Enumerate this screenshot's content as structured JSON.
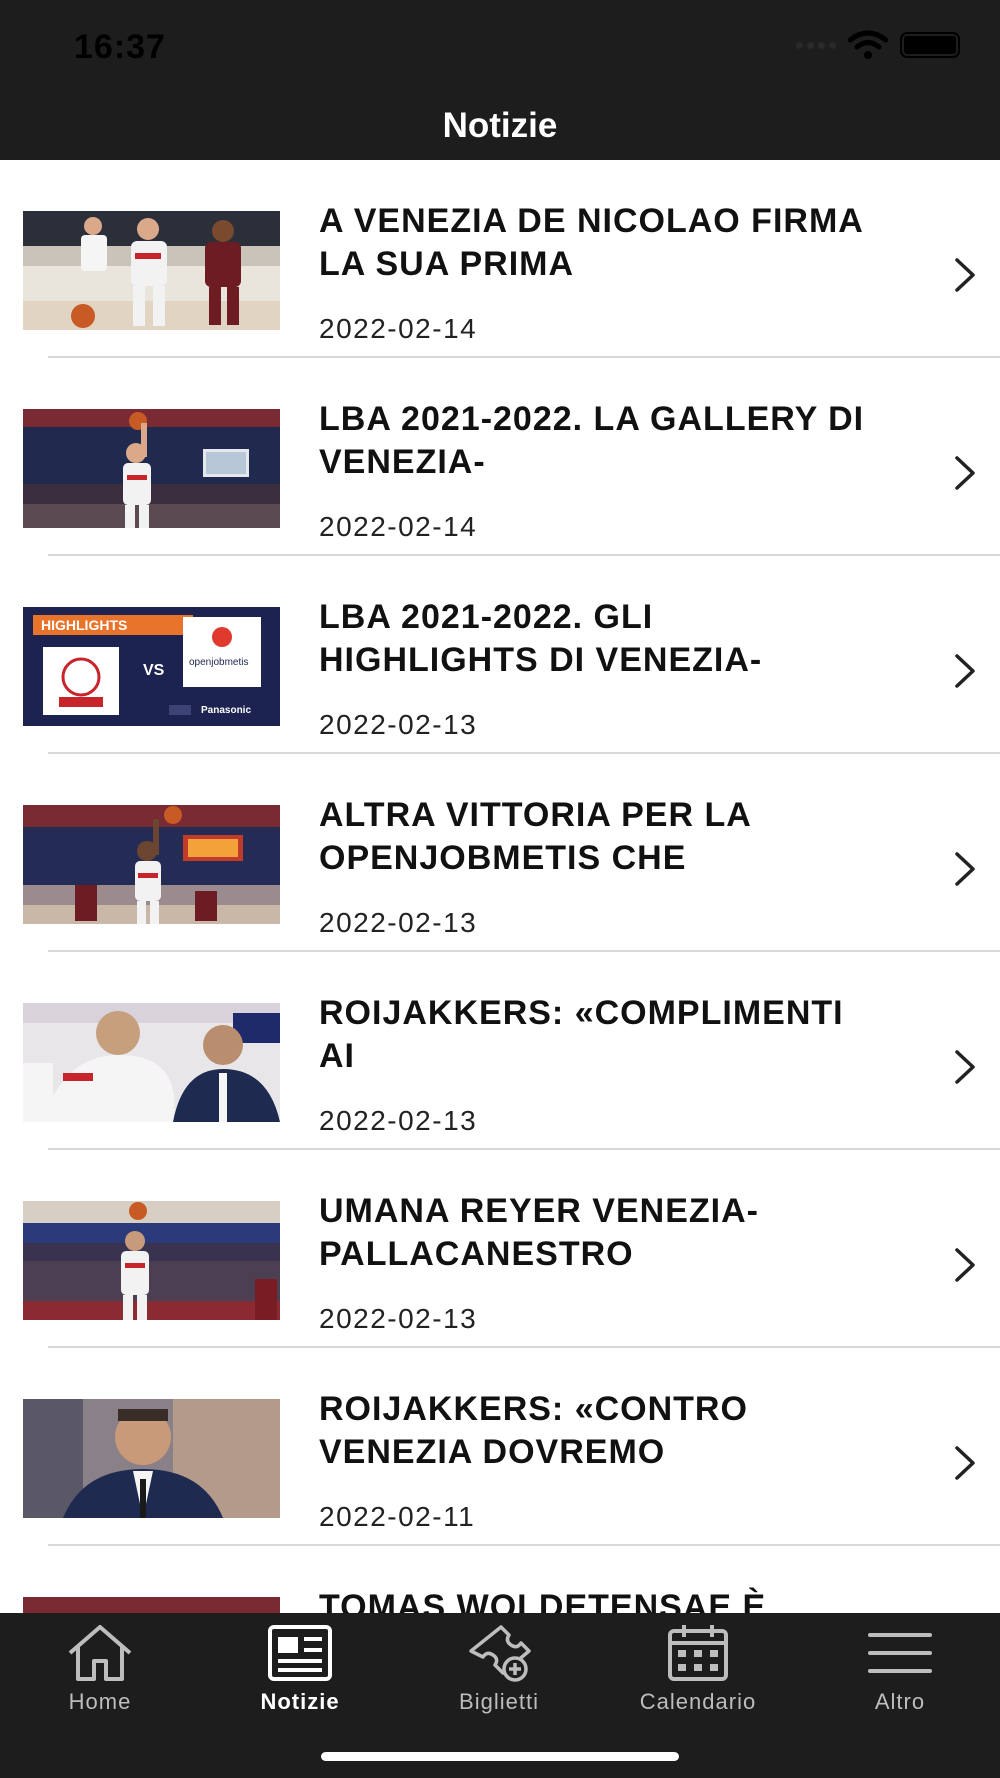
{
  "status_bar": {
    "time": "16:37",
    "icons": [
      "signal-dots-icon",
      "wifi-icon",
      "battery-icon"
    ]
  },
  "nav": {
    "title": "Notizie"
  },
  "news": [
    {
      "title": "A VENEZIA DE NICOLAO FIRMA LA SUA PRIMA",
      "date": "2022-02-14",
      "image": "basketball-action-photo"
    },
    {
      "title": "LBA 2021-2022. LA GALLERY DI VENEZIA-",
      "date": "2022-02-14",
      "image": "basketball-arena-photo"
    },
    {
      "title": "LBA 2021-2022. GLI HIGHLIGHTS DI VENEZIA-",
      "date": "2022-02-13",
      "image": "highlights-graphic",
      "image_text": {
        "label": "HIGHLIGHTS",
        "vs": "VS",
        "team_right": "openjobmetis",
        "sponsor": "Panasonic"
      }
    },
    {
      "title": "ALTRA VITTORIA PER LA OPENJOBMETIS CHE",
      "date": "2022-02-13",
      "image": "basketball-arena-photo"
    },
    {
      "title": "ROIJAKKERS: «COMPLIMENTI AI",
      "date": "2022-02-13",
      "image": "team-huddle-photo"
    },
    {
      "title": "UMANA REYER VENEZIA-PALLACANESTRO",
      "date": "2022-02-13",
      "image": "free-throw-photo"
    },
    {
      "title": "ROIJAKKERS: «CONTRO VENEZIA DOVREMO",
      "date": "2022-02-11",
      "image": "coach-portrait-photo"
    },
    {
      "title": "TOMAS WOLDETENSAE È",
      "date": "",
      "image": "basketball-arena-photo"
    }
  ],
  "tabs": [
    {
      "label": "Home",
      "icon": "home-icon",
      "active": false
    },
    {
      "label": "Notizie",
      "icon": "newspaper-icon",
      "active": true
    },
    {
      "label": "Biglietti",
      "icon": "ticket-icon",
      "active": false
    },
    {
      "label": "Calendario",
      "icon": "calendar-icon",
      "active": false
    },
    {
      "label": "Altro",
      "icon": "menu-icon",
      "active": false
    }
  ],
  "colors": {
    "bar_background": "#1d1d1d",
    "text_primary": "#111111",
    "tab_inactive": "#bdbdbd",
    "highlight_orange": "#e8732a"
  }
}
